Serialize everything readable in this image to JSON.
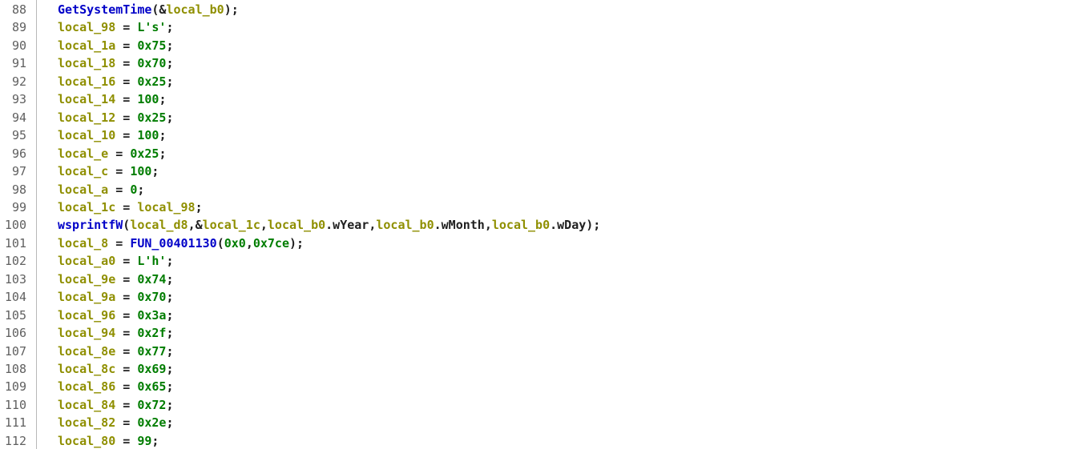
{
  "colors": {
    "background": "#ffffff",
    "line_number": "#606060",
    "variable": "#8f8f00",
    "function": "#0000c8",
    "number": "#007d00",
    "string": "#007d00",
    "punctuation": "#202020",
    "gutter_divider": "#b8b8b8"
  },
  "lines": [
    {
      "number": "88",
      "tokens": [
        {
          "t": "fn",
          "v": "GetSystemTime"
        },
        {
          "t": "op",
          "v": "(&"
        },
        {
          "t": "var",
          "v": "local_b0"
        },
        {
          "t": "op",
          "v": ");"
        }
      ]
    },
    {
      "number": "89",
      "tokens": [
        {
          "t": "var",
          "v": "local_98"
        },
        {
          "t": "op",
          "v": " = "
        },
        {
          "t": "str",
          "v": "L's'"
        },
        {
          "t": "op",
          "v": ";"
        }
      ]
    },
    {
      "number": "90",
      "tokens": [
        {
          "t": "var",
          "v": "local_1a"
        },
        {
          "t": "op",
          "v": " = "
        },
        {
          "t": "num",
          "v": "0x75"
        },
        {
          "t": "op",
          "v": ";"
        }
      ]
    },
    {
      "number": "91",
      "tokens": [
        {
          "t": "var",
          "v": "local_18"
        },
        {
          "t": "op",
          "v": " = "
        },
        {
          "t": "num",
          "v": "0x70"
        },
        {
          "t": "op",
          "v": ";"
        }
      ]
    },
    {
      "number": "92",
      "tokens": [
        {
          "t": "var",
          "v": "local_16"
        },
        {
          "t": "op",
          "v": " = "
        },
        {
          "t": "num",
          "v": "0x25"
        },
        {
          "t": "op",
          "v": ";"
        }
      ]
    },
    {
      "number": "93",
      "tokens": [
        {
          "t": "var",
          "v": "local_14"
        },
        {
          "t": "op",
          "v": " = "
        },
        {
          "t": "num",
          "v": "100"
        },
        {
          "t": "op",
          "v": ";"
        }
      ]
    },
    {
      "number": "94",
      "tokens": [
        {
          "t": "var",
          "v": "local_12"
        },
        {
          "t": "op",
          "v": " = "
        },
        {
          "t": "num",
          "v": "0x25"
        },
        {
          "t": "op",
          "v": ";"
        }
      ]
    },
    {
      "number": "95",
      "tokens": [
        {
          "t": "var",
          "v": "local_10"
        },
        {
          "t": "op",
          "v": " = "
        },
        {
          "t": "num",
          "v": "100"
        },
        {
          "t": "op",
          "v": ";"
        }
      ]
    },
    {
      "number": "96",
      "tokens": [
        {
          "t": "var",
          "v": "local_e"
        },
        {
          "t": "op",
          "v": " = "
        },
        {
          "t": "num",
          "v": "0x25"
        },
        {
          "t": "op",
          "v": ";"
        }
      ]
    },
    {
      "number": "97",
      "tokens": [
        {
          "t": "var",
          "v": "local_c"
        },
        {
          "t": "op",
          "v": " = "
        },
        {
          "t": "num",
          "v": "100"
        },
        {
          "t": "op",
          "v": ";"
        }
      ]
    },
    {
      "number": "98",
      "tokens": [
        {
          "t": "var",
          "v": "local_a"
        },
        {
          "t": "op",
          "v": " = "
        },
        {
          "t": "num",
          "v": "0"
        },
        {
          "t": "op",
          "v": ";"
        }
      ]
    },
    {
      "number": "99",
      "tokens": [
        {
          "t": "var",
          "v": "local_1c"
        },
        {
          "t": "op",
          "v": " = "
        },
        {
          "t": "var",
          "v": "local_98"
        },
        {
          "t": "op",
          "v": ";"
        }
      ]
    },
    {
      "number": "100",
      "tokens": [
        {
          "t": "fn",
          "v": "wsprintfW"
        },
        {
          "t": "op",
          "v": "("
        },
        {
          "t": "var",
          "v": "local_d8"
        },
        {
          "t": "op",
          "v": ",&"
        },
        {
          "t": "var",
          "v": "local_1c"
        },
        {
          "t": "op",
          "v": ","
        },
        {
          "t": "var",
          "v": "local_b0"
        },
        {
          "t": "op",
          "v": ".wYear,"
        },
        {
          "t": "var",
          "v": "local_b0"
        },
        {
          "t": "op",
          "v": ".wMonth,"
        },
        {
          "t": "var",
          "v": "local_b0"
        },
        {
          "t": "op",
          "v": ".wDay);"
        }
      ]
    },
    {
      "number": "101",
      "tokens": [
        {
          "t": "var",
          "v": "local_8"
        },
        {
          "t": "op",
          "v": " = "
        },
        {
          "t": "fn",
          "v": "FUN_00401130"
        },
        {
          "t": "op",
          "v": "("
        },
        {
          "t": "num",
          "v": "0x0"
        },
        {
          "t": "op",
          "v": ","
        },
        {
          "t": "num",
          "v": "0x7ce"
        },
        {
          "t": "op",
          "v": ");"
        }
      ]
    },
    {
      "number": "102",
      "tokens": [
        {
          "t": "var",
          "v": "local_a0"
        },
        {
          "t": "op",
          "v": " = "
        },
        {
          "t": "str",
          "v": "L'h'"
        },
        {
          "t": "op",
          "v": ";"
        }
      ]
    },
    {
      "number": "103",
      "tokens": [
        {
          "t": "var",
          "v": "local_9e"
        },
        {
          "t": "op",
          "v": " = "
        },
        {
          "t": "num",
          "v": "0x74"
        },
        {
          "t": "op",
          "v": ";"
        }
      ]
    },
    {
      "number": "104",
      "tokens": [
        {
          "t": "var",
          "v": "local_9a"
        },
        {
          "t": "op",
          "v": " = "
        },
        {
          "t": "num",
          "v": "0x70"
        },
        {
          "t": "op",
          "v": ";"
        }
      ]
    },
    {
      "number": "105",
      "tokens": [
        {
          "t": "var",
          "v": "local_96"
        },
        {
          "t": "op",
          "v": " = "
        },
        {
          "t": "num",
          "v": "0x3a"
        },
        {
          "t": "op",
          "v": ";"
        }
      ]
    },
    {
      "number": "106",
      "tokens": [
        {
          "t": "var",
          "v": "local_94"
        },
        {
          "t": "op",
          "v": " = "
        },
        {
          "t": "num",
          "v": "0x2f"
        },
        {
          "t": "op",
          "v": ";"
        }
      ]
    },
    {
      "number": "107",
      "tokens": [
        {
          "t": "var",
          "v": "local_8e"
        },
        {
          "t": "op",
          "v": " = "
        },
        {
          "t": "num",
          "v": "0x77"
        },
        {
          "t": "op",
          "v": ";"
        }
      ]
    },
    {
      "number": "108",
      "tokens": [
        {
          "t": "var",
          "v": "local_8c"
        },
        {
          "t": "op",
          "v": " = "
        },
        {
          "t": "num",
          "v": "0x69"
        },
        {
          "t": "op",
          "v": ";"
        }
      ]
    },
    {
      "number": "109",
      "tokens": [
        {
          "t": "var",
          "v": "local_86"
        },
        {
          "t": "op",
          "v": " = "
        },
        {
          "t": "num",
          "v": "0x65"
        },
        {
          "t": "op",
          "v": ";"
        }
      ]
    },
    {
      "number": "110",
      "tokens": [
        {
          "t": "var",
          "v": "local_84"
        },
        {
          "t": "op",
          "v": " = "
        },
        {
          "t": "num",
          "v": "0x72"
        },
        {
          "t": "op",
          "v": ";"
        }
      ]
    },
    {
      "number": "111",
      "tokens": [
        {
          "t": "var",
          "v": "local_82"
        },
        {
          "t": "op",
          "v": " = "
        },
        {
          "t": "num",
          "v": "0x2e"
        },
        {
          "t": "op",
          "v": ";"
        }
      ]
    },
    {
      "number": "112",
      "tokens": [
        {
          "t": "var",
          "v": "local_80"
        },
        {
          "t": "op",
          "v": " = "
        },
        {
          "t": "num",
          "v": "99"
        },
        {
          "t": "op",
          "v": ";"
        }
      ]
    }
  ]
}
